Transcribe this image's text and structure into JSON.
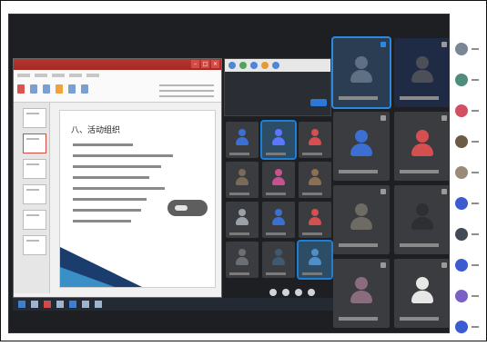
{
  "colors": {
    "accent": "#1e7fd6",
    "meeting_bg": "#1d1f22",
    "tile_bg": "#3a3c40",
    "doc_title_red": "#b7352f"
  },
  "icons": {
    "participant_avatar": "person-avatar-icon",
    "controls": [
      "mic-icon",
      "camera-icon",
      "share-icon",
      "more-icon"
    ]
  },
  "document_window": {
    "app_name": "",
    "slide_title": "八、活动组织"
  },
  "center_grid": {
    "tiles": [
      {
        "avatar_color": "#3b6fd1"
      },
      {
        "avatar_color": "#5b77ff",
        "selected": true
      },
      {
        "avatar_color": "#d44f4f"
      },
      {
        "avatar_color": "#7a6a58"
      },
      {
        "avatar_color": "#c7528f"
      },
      {
        "avatar_color": "#8c6f52"
      },
      {
        "avatar_color": "#9aa1a8"
      },
      {
        "avatar_color": "#3b6fd1"
      },
      {
        "avatar_color": "#d44f4f"
      },
      {
        "avatar_color": "#6b6f74"
      },
      {
        "avatar_color": "#3f5a70"
      },
      {
        "avatar_color": "#4c8fc9",
        "selected": true
      }
    ]
  },
  "big_grid": {
    "tiles": [
      {
        "avatar_color": "#5f6f84",
        "selected": true,
        "corner": "blue"
      },
      {
        "avatar_color": "#4b4f57",
        "dark_blue": true
      },
      {
        "avatar_color": "#3b6fd1"
      },
      {
        "avatar_color": "#d44f4f"
      },
      {
        "avatar_color": "#6e6a64"
      },
      {
        "avatar_color": "#2d2f33"
      },
      {
        "avatar_color": "#8a6c7e"
      },
      {
        "avatar_color": "#e7e7e7"
      }
    ]
  },
  "participants": {
    "items": [
      {
        "color": "#7a8694"
      },
      {
        "color": "#4f8c7b"
      },
      {
        "color": "#d24f62"
      },
      {
        "color": "#6a5a46"
      },
      {
        "color": "#9b8a77"
      },
      {
        "color": "#3b5bd1"
      },
      {
        "color": "#424a55"
      },
      {
        "color": "#3b5bd1"
      },
      {
        "color": "#7a5fc4"
      },
      {
        "color": "#3b5bd1"
      }
    ]
  }
}
